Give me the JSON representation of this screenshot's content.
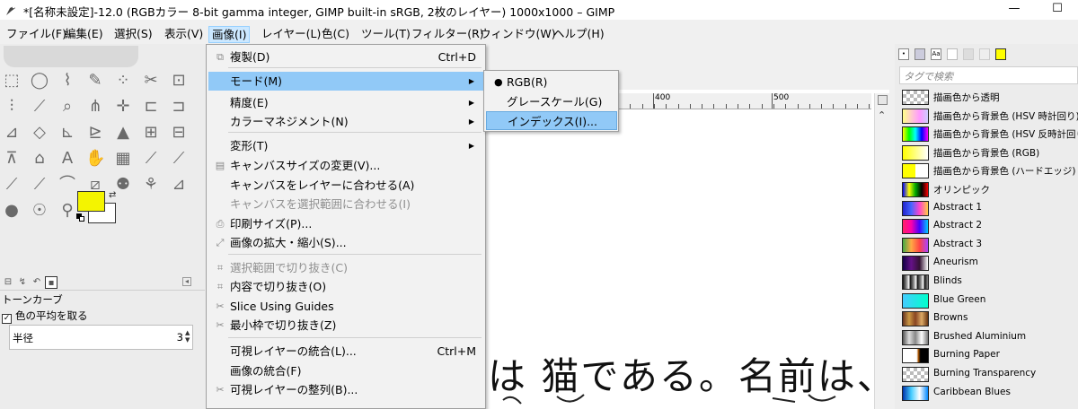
{
  "window": {
    "title": "*[名称未設定]-12.0 (RGBカラー 8-bit gamma integer, GIMP built-in sRGB, 2枚のレイヤー) 1000x1000 – GIMP",
    "minimize": "—",
    "maximize": "☐"
  },
  "menubar": [
    {
      "label": "ファイル(F)"
    },
    {
      "label": "編集(E)"
    },
    {
      "label": "選択(S)"
    },
    {
      "label": "表示(V)"
    },
    {
      "label": "画像(I)",
      "active": true
    },
    {
      "label": "レイヤー(L)"
    },
    {
      "label": "色(C)"
    },
    {
      "label": "ツール(T)"
    },
    {
      "label": "フィルター(R)"
    },
    {
      "label": "ウィンドウ(W)"
    },
    {
      "label": "ヘルプ(H)"
    }
  ],
  "image_menu": [
    {
      "label": "複製(D)",
      "shortcut": "Ctrl+D",
      "icon": "⧉"
    },
    {
      "label": "モード(M)",
      "submenu": true,
      "highlighted": true
    },
    {
      "label": "精度(E)",
      "submenu": true
    },
    {
      "label": "カラーマネジメント(N)",
      "submenu": true
    },
    {
      "label": "変形(T)",
      "submenu": true
    },
    {
      "label": "キャンバスサイズの変更(V)...",
      "icon": "▤"
    },
    {
      "label": "キャンバスをレイヤーに合わせる(A)"
    },
    {
      "label": "キャンバスを選択範囲に合わせる(I)",
      "disabled": true
    },
    {
      "label": "印刷サイズ(P)...",
      "icon": "⎙"
    },
    {
      "label": "画像の拡大・縮小(S)...",
      "icon": "⤢"
    },
    {
      "label": "選択範囲で切り抜き(C)",
      "disabled": true,
      "icon": "⌗"
    },
    {
      "label": "内容で切り抜き(O)",
      "icon": "⌗"
    },
    {
      "label": "Slice Using Guides",
      "icon": "✂"
    },
    {
      "label": "最小枠で切り抜き(Z)",
      "icon": "✂"
    },
    {
      "label": "可視レイヤーの統合(L)...",
      "shortcut": "Ctrl+M"
    },
    {
      "label": "画像の統合(F)"
    },
    {
      "label": "可視レイヤーの整列(B)...",
      "icon": "✂"
    }
  ],
  "mode_submenu": [
    {
      "label": "RGB(R)",
      "checked": true
    },
    {
      "label": "グレースケール(G)"
    },
    {
      "label": "インデックス(I)...",
      "highlighted": true
    }
  ],
  "toolbox": {
    "panel_title": "トーンカーブ",
    "average_checkbox": "色の平均を取る",
    "radius_label": "半径",
    "radius_value": "3",
    "fg_color": "#f4f400",
    "bg_color": "#ffffff"
  },
  "canvas": {
    "ruler_labels": [
      "400",
      "500"
    ],
    "text": "は 猫である。名前は、"
  },
  "gradients": {
    "filter_placeholder": "タグで検索",
    "items": [
      {
        "name": "描画色から透明",
        "css": "repeating-conic-gradient(#bbb 0 25%, #fff 0 50%) 0 0/8px 8px, linear-gradient(90deg,#ff0,#ff0 10%,transparent)"
      },
      {
        "name": "描画色から背景色 (HSV 時計回り)",
        "css": "linear-gradient(90deg,#ff8,#fcc,#f9f,#ccf)"
      },
      {
        "name": "描画色から背景色 (HSV 反時計回り)",
        "css": "linear-gradient(90deg,#ff0,#0f0,#0ff,#00f,#f0f)"
      },
      {
        "name": "描画色から背景色 (RGB)",
        "css": "linear-gradient(90deg,#ff0,#fff)"
      },
      {
        "name": "描画色から背景色 (ハードエッジ)",
        "css": "linear-gradient(90deg,#ff0,#ff0 50%,#fff 50%)"
      },
      {
        "name": "オリンピック",
        "css": "linear-gradient(90deg,#00f,#ff0,#0a0,#000,#f00)"
      },
      {
        "name": "Abstract 1",
        "css": "linear-gradient(90deg,#22c,#46f,#f4c,#fc4)"
      },
      {
        "name": "Abstract 2",
        "css": "linear-gradient(90deg,#f26,#f0a,#40f,#0cf)"
      },
      {
        "name": "Abstract 3",
        "css": "linear-gradient(90deg,#4a4,#fa4,#f44,#a4f)"
      },
      {
        "name": "Aneurism",
        "css": "linear-gradient(90deg,#104,#618,#313,#fff)"
      },
      {
        "name": "Blinds",
        "css": "repeating-linear-gradient(90deg,#111 0,#888 4px,#fff 7px,#111 8px)"
      },
      {
        "name": "Blue Green",
        "css": "linear-gradient(90deg,#4cf,#0fc)"
      },
      {
        "name": "Browns",
        "css": "linear-gradient(90deg,#632,#c94,#842,#da6,#631)"
      },
      {
        "name": "Brushed Aluminium",
        "css": "linear-gradient(90deg,#555,#ddd,#888,#fff,#777)"
      },
      {
        "name": "Burning Paper",
        "css": "linear-gradient(90deg,#fff 55%,#a50 62%,#000 70%)"
      },
      {
        "name": "Burning Transparency",
        "css": "repeating-conic-gradient(#bbb 0 25%, #fff 0 50%) 0 0/8px 8px"
      },
      {
        "name": "Caribbean Blues",
        "css": "linear-gradient(90deg,#03a,#4cf,#fff,#08f)"
      }
    ]
  }
}
